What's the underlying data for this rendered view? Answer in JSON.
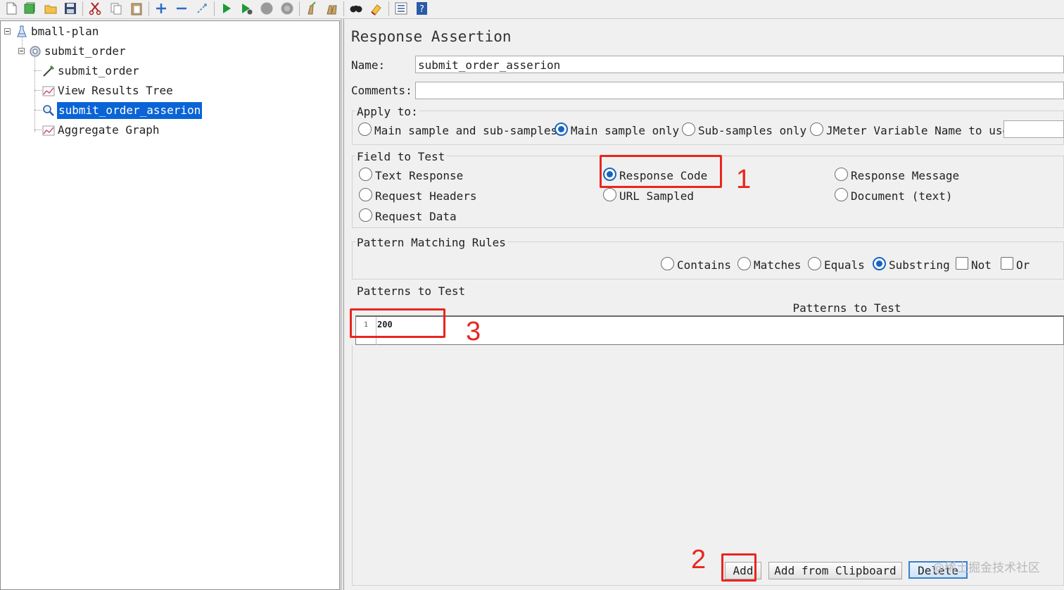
{
  "toolbar": {
    "icons": [
      "new-icon",
      "templates-icon",
      "open-icon",
      "save-icon",
      "cut-icon",
      "copy-icon",
      "paste-icon",
      "expand-icon",
      "collapse-icon",
      "toggle-icon",
      "start-icon",
      "start-no-pause-icon",
      "stop-icon",
      "shutdown-icon",
      "clear-icon",
      "clear-all-icon",
      "search-icon",
      "reset-search-icon",
      "function-helper-icon",
      "help-icon"
    ]
  },
  "tree": {
    "items": [
      {
        "label": "bmall-plan",
        "icon": "test-plan-icon"
      },
      {
        "label": "submit_order",
        "icon": "thread-group-icon"
      },
      {
        "label": "submit_order",
        "icon": "http-sampler-icon"
      },
      {
        "label": "View Results Tree",
        "icon": "listener-icon"
      },
      {
        "label": "submit_order_asserion",
        "icon": "assertion-icon",
        "selected": true
      },
      {
        "label": "Aggregate Graph",
        "icon": "listener-icon"
      }
    ]
  },
  "panel": {
    "title": "Response Assertion",
    "name_label": "Name:",
    "name_value": "submit_order_asserion",
    "comments_label": "Comments:",
    "comments_value": ""
  },
  "apply_to": {
    "title": "Apply to:",
    "options": [
      {
        "label": "Main sample and sub-samples",
        "selected": false
      },
      {
        "label": "Main sample only",
        "selected": true
      },
      {
        "label": "Sub-samples only",
        "selected": false
      },
      {
        "label": "JMeter Variable Name to use",
        "selected": false
      }
    ],
    "variable_value": ""
  },
  "field_to_test": {
    "title": "Field to Test",
    "options": [
      {
        "label": "Text Response",
        "selected": false
      },
      {
        "label": "Request Headers",
        "selected": false
      },
      {
        "label": "Request Data",
        "selected": false
      },
      {
        "label": "Response Code",
        "selected": true
      },
      {
        "label": "URL Sampled",
        "selected": false
      },
      {
        "label": "Response Message",
        "selected": false
      },
      {
        "label": "Document (text)",
        "selected": false
      }
    ]
  },
  "matching_rules": {
    "title": "Pattern Matching Rules",
    "options": [
      {
        "label": "Contains",
        "selected": false
      },
      {
        "label": "Matches",
        "selected": false
      },
      {
        "label": "Equals",
        "selected": false
      },
      {
        "label": "Substring",
        "selected": true
      }
    ],
    "checks": [
      {
        "label": "Not",
        "checked": false
      },
      {
        "label": "Or",
        "checked": false
      }
    ]
  },
  "patterns": {
    "title": "Patterns to Test",
    "column_header": "Patterns to Test",
    "rows": [
      {
        "num": "1",
        "value": "200"
      }
    ]
  },
  "buttons": {
    "add": "Add",
    "add_clipboard": "Add from Clipboard",
    "delete": "Delete"
  },
  "annotations": {
    "one": "1",
    "two": "2",
    "three": "3",
    "color": "#e8261f"
  },
  "watermark": "@稀土掘金技术社区",
  "colors": {
    "selection": "#0a64d6",
    "radio_selected": "#1565c0"
  }
}
